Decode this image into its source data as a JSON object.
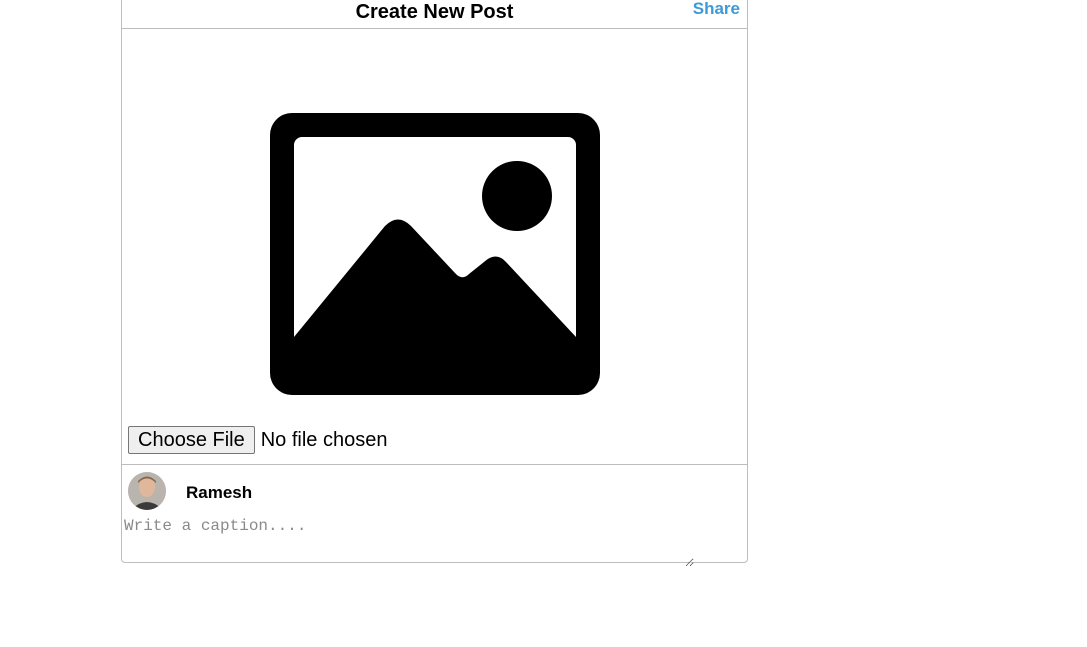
{
  "header": {
    "title": "Create New Post",
    "share_label": "Share"
  },
  "media": {
    "placeholder_icon": "image-placeholder-icon",
    "file_button_label": "Choose File",
    "file_status": "No file chosen"
  },
  "user": {
    "name": "Ramesh",
    "avatar_icon": "user-avatar"
  },
  "caption": {
    "placeholder": "Write a caption....",
    "value": ""
  },
  "colors": {
    "accent": "#3d9ad6",
    "border": "#bdbdbd"
  }
}
